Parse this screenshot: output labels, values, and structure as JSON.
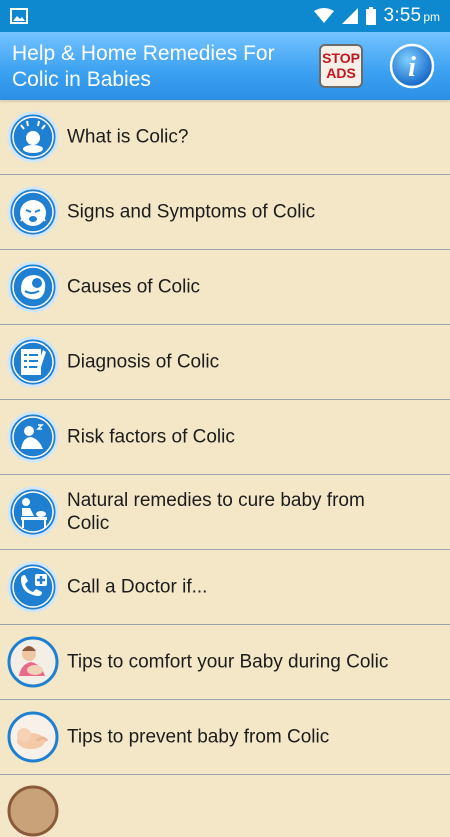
{
  "status_bar": {
    "time": "3:55",
    "ampm": "pm",
    "icons": [
      "image-notification-icon",
      "wifi-icon",
      "signal-icon",
      "battery-icon"
    ]
  },
  "app_bar": {
    "title": "Help & Home Remedies For\nColic in Babies",
    "stop_ads_line1": "STOP",
    "stop_ads_line2": "ADS",
    "info_icon": "info-icon"
  },
  "menu": {
    "items": [
      {
        "label": "What is Colic?",
        "icon": "crying-baby-icon"
      },
      {
        "label": "Signs and Symptoms of Colic",
        "icon": "sad-face-icon"
      },
      {
        "label": "Causes of Colic",
        "icon": "baby-in-womb-icon"
      },
      {
        "label": "Diagnosis of Colic",
        "icon": "checklist-icon"
      },
      {
        "label": "Risk factors of Colic",
        "icon": "sleeping-person-icon"
      },
      {
        "label": "Natural remedies to cure baby from Colic",
        "icon": "changing-table-icon"
      },
      {
        "label": "Call a Doctor if...",
        "icon": "phone-medical-icon"
      },
      {
        "label": "Tips to comfort your Baby during Colic",
        "icon": "mother-baby-icon"
      },
      {
        "label": "Tips to prevent baby from Colic",
        "icon": "baby-photo-icon"
      }
    ]
  },
  "colors": {
    "status_bar": "#0e88cf",
    "app_bar": "#3aa0f0",
    "background": "#f3e7c7",
    "icon_blue": "#1f7fd0",
    "stop_ads_red": "#c4161c"
  }
}
